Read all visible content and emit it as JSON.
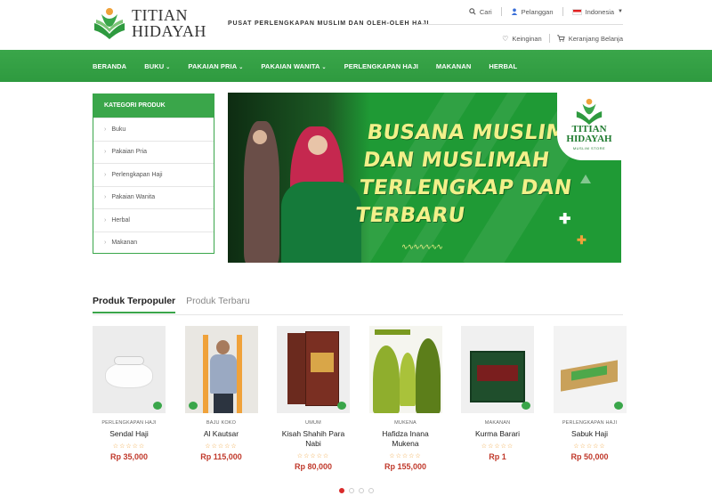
{
  "brand": {
    "name_line1": "TITIAN",
    "name_line2": "HIDAYAH",
    "tagline": "PUSAT PERLENGKAPAN MUSLIM DAN OLEH-OLEH HAJI",
    "primary_color": "#3aa64a"
  },
  "top_links": {
    "search": "Cari",
    "customer": "Pelanggan",
    "language": "Indonesia",
    "wishlist": "Keinginan",
    "cart": "Keranjang Belanja"
  },
  "nav": {
    "items": [
      {
        "label": "BERANDA",
        "has_dropdown": false
      },
      {
        "label": "BUKU",
        "has_dropdown": true
      },
      {
        "label": "PAKAIAN PRIA",
        "has_dropdown": true
      },
      {
        "label": "PAKAIAN WANITA",
        "has_dropdown": true
      },
      {
        "label": "PERLENGKAPAN HAJI",
        "has_dropdown": false
      },
      {
        "label": "MAKANAN",
        "has_dropdown": false
      },
      {
        "label": "HERBAL",
        "has_dropdown": false
      }
    ]
  },
  "categories": {
    "title": "KATEGORI PRODUK",
    "items": [
      "Buku",
      "Pakaian Pria",
      "Perlengkapan Haji",
      "Pakaian Wanita",
      "Herbal",
      "Makanan"
    ]
  },
  "banner": {
    "lines": [
      "BUSANA MUSLIM",
      "DAN MUSLIMAH",
      "TERLENGKAP DAN",
      "TERBARU"
    ],
    "logo_line1": "TITIAN",
    "logo_line2": "HIDAYAH",
    "logo_sub": "MUSLIM STORE"
  },
  "tabs": {
    "popular": "Produk Terpopuler",
    "newest": "Produk Terbaru"
  },
  "products": [
    {
      "category": "PERLENGKAPAN HAJI",
      "name": "Sendal Haji",
      "price": "Rp 35,000",
      "stars": "☆☆☆☆☆"
    },
    {
      "category": "BAJU KOKO",
      "name": "Al Kautsar",
      "price": "Rp 115,000",
      "stars": "☆☆☆☆☆"
    },
    {
      "category": "UMUM",
      "name": "Kisah Shahih Para Nabi",
      "price": "Rp 80,000",
      "stars": "☆☆☆☆☆"
    },
    {
      "category": "MUKENA",
      "name": "Hafidza Inana Mukena",
      "price": "Rp 155,000",
      "stars": "☆☆☆☆☆"
    },
    {
      "category": "MAKANAN",
      "name": "Kurma Barari",
      "price": "Rp 1",
      "stars": "☆☆☆☆☆"
    },
    {
      "category": "PERLENGKAPAN HAJI",
      "name": "Sabuk Haji",
      "price": "Rp 50,000",
      "stars": "☆☆☆☆☆"
    }
  ],
  "carousel": {
    "pages": 4,
    "active": 1
  }
}
